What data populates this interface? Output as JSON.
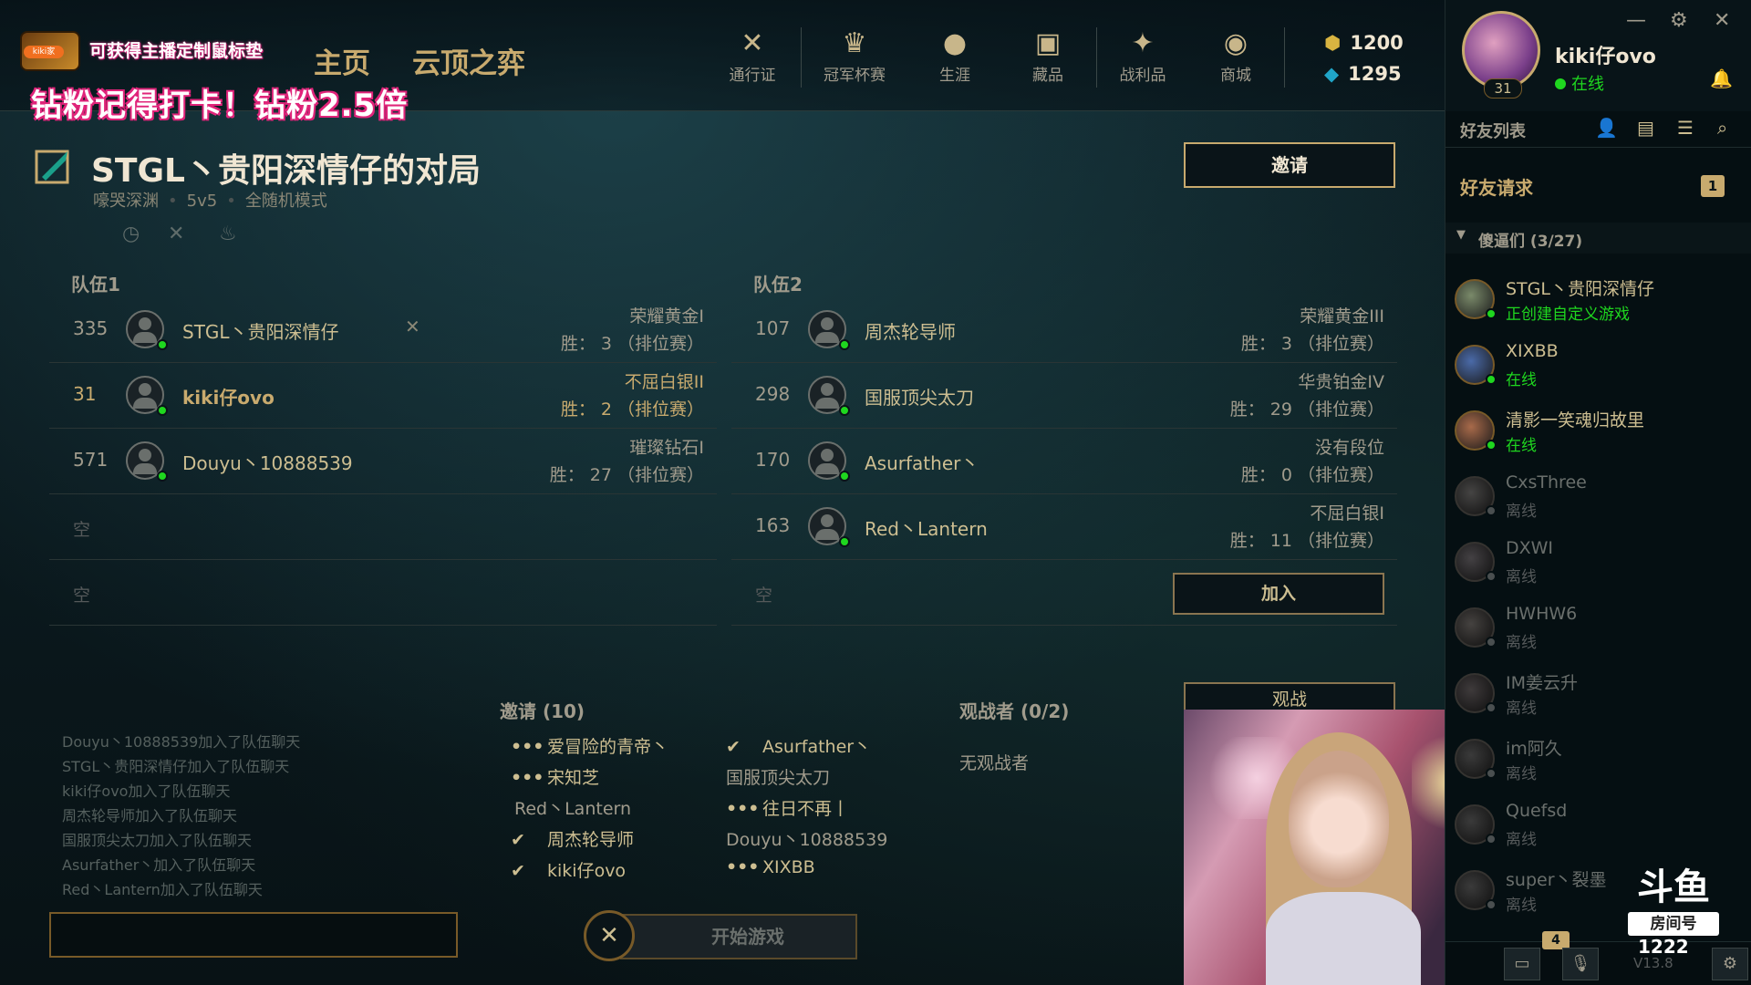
{
  "stream_overlay": {
    "promo_pill": "kiki家",
    "promo_line1": "可获得主播定制鼠标垫",
    "promo_line2": "钻粉记得打卡！钻粉2.5倍",
    "room_logo": "斗鱼",
    "room_tag": "房间号",
    "room_number": "1222"
  },
  "nav": {
    "home": "主页",
    "tft": "云顶之弈",
    "items": [
      {
        "label": "通行证",
        "icon": "pass-icon",
        "glyph": "✕"
      },
      {
        "label": "冠军杯赛",
        "icon": "trophy-icon",
        "glyph": "♛"
      },
      {
        "label": "生涯",
        "icon": "profile-icon",
        "glyph": "●"
      },
      {
        "label": "藏品",
        "icon": "collection-icon",
        "glyph": "▣"
      },
      {
        "label": "战利品",
        "icon": "loot-icon",
        "glyph": "✦"
      },
      {
        "label": "商城",
        "icon": "store-icon",
        "glyph": "◉"
      }
    ],
    "currency_be": "1200",
    "currency_rp": "1295"
  },
  "profile": {
    "name": "kiki仔ovo",
    "status": "在线",
    "level": "31"
  },
  "social": {
    "friends_title": "好友列表",
    "friend_requests_label": "好友请求",
    "friend_requests_count": "1",
    "group_label": "傻逼们 (3/27)",
    "friends": [
      {
        "name": "STGL丶贵阳深情仔",
        "status": "正创建自定义游戏",
        "online": true,
        "color": "#7a8a6a"
      },
      {
        "name": "XIXBB",
        "status": "在线",
        "online": true,
        "color": "#4a6aa8"
      },
      {
        "name": "清影一笑魂归故里",
        "status": "在线",
        "online": true,
        "color": "#a86a4a"
      },
      {
        "name": "CxsThree",
        "status": "离线",
        "online": false,
        "color": "#8a7a6a"
      },
      {
        "name": "DXWI",
        "status": "离线",
        "online": false,
        "color": "#9a6a9a"
      },
      {
        "name": "HWHW6",
        "status": "离线",
        "online": false,
        "color": "#a8704a"
      },
      {
        "name": "IM姜云升",
        "status": "离线",
        "online": false,
        "color": "#a85a6a"
      },
      {
        "name": "im阿久",
        "status": "离线",
        "online": false,
        "color": "#6a6a6a"
      },
      {
        "name": "Quefsd",
        "status": "离线",
        "online": false,
        "color": "#6a6a6a"
      },
      {
        "name": "super丶裂墨",
        "status": "离线",
        "online": false,
        "color": "#6a6a6a"
      }
    ],
    "bottom_badge": "4",
    "version": "V13.8"
  },
  "lobby": {
    "title": "STGL丶贵阳深情仔的对局",
    "map": "嚎哭深渊",
    "size": "5v5",
    "mode": "全随机模式",
    "invite_button": "邀请",
    "join_button": "加入",
    "team1_label": "队伍1",
    "team2_label": "队伍2",
    "empty_label": "空",
    "team1": [
      {
        "level": "335",
        "name": "STGL丶贵阳深情仔",
        "rank": "荣耀黄金I",
        "wins": "胜： 3 （排位赛）",
        "owner": true,
        "me": false
      },
      {
        "level": "31",
        "name": "kiki仔ovo",
        "rank": "不屈白银II",
        "wins": "胜： 2 （排位赛）",
        "owner": false,
        "me": true
      },
      {
        "level": "571",
        "name": "Douyu丶10888539",
        "rank": "璀璨钻石I",
        "wins": "胜： 27 （排位赛）",
        "owner": false,
        "me": false
      }
    ],
    "team2": [
      {
        "level": "107",
        "name": "周杰轮导师",
        "rank": "荣耀黄金III",
        "wins": "胜： 3 （排位赛）"
      },
      {
        "level": "298",
        "name": "国服顶尖太刀",
        "rank": "华贵铂金IV",
        "wins": "胜： 29 （排位赛）"
      },
      {
        "level": "170",
        "name": "Asurfather丶",
        "rank": "没有段位",
        "wins": "胜： 0 （排位赛）"
      },
      {
        "level": "163",
        "name": "Red丶Lantern",
        "rank": "不屈白银I",
        "wins": "胜： 11 （排位赛）"
      }
    ],
    "chat_log": [
      "Douyu丶10888539加入了队伍聊天",
      "STGL丶贵阳深情仔加入了队伍聊天",
      "kiki仔ovo加入了队伍聊天",
      "周杰轮导师加入了队伍聊天",
      "国服顶尖太刀加入了队伍聊天",
      "Asurfather丶加入了队伍聊天",
      "Red丶Lantern加入了队伍聊天"
    ],
    "invites_title": "邀请 (10)",
    "invites": [
      {
        "mark": "•••",
        "name": "爱冒险的青帝丶"
      },
      {
        "mark": "•••",
        "name": "宋知芝"
      },
      {
        "mark": "",
        "name": "Red丶Lantern"
      },
      {
        "mark": "✔",
        "name": "周杰轮导师"
      },
      {
        "mark": "✔",
        "name": "kiki仔ovo"
      },
      {
        "mark": "✔",
        "name": "Asurfather丶"
      },
      {
        "mark": "",
        "name": "国服顶尖太刀"
      },
      {
        "mark": "•••",
        "name": "往日不再丨"
      },
      {
        "mark": "",
        "name": "Douyu丶10888539"
      },
      {
        "mark": "•••",
        "name": "XIXBB"
      }
    ],
    "spectators_title": "观战者 (0/2)",
    "spectate_button": "观战",
    "no_spectators": "无观战者",
    "start_button": "开始游戏",
    "cancel_icon": "✕"
  }
}
